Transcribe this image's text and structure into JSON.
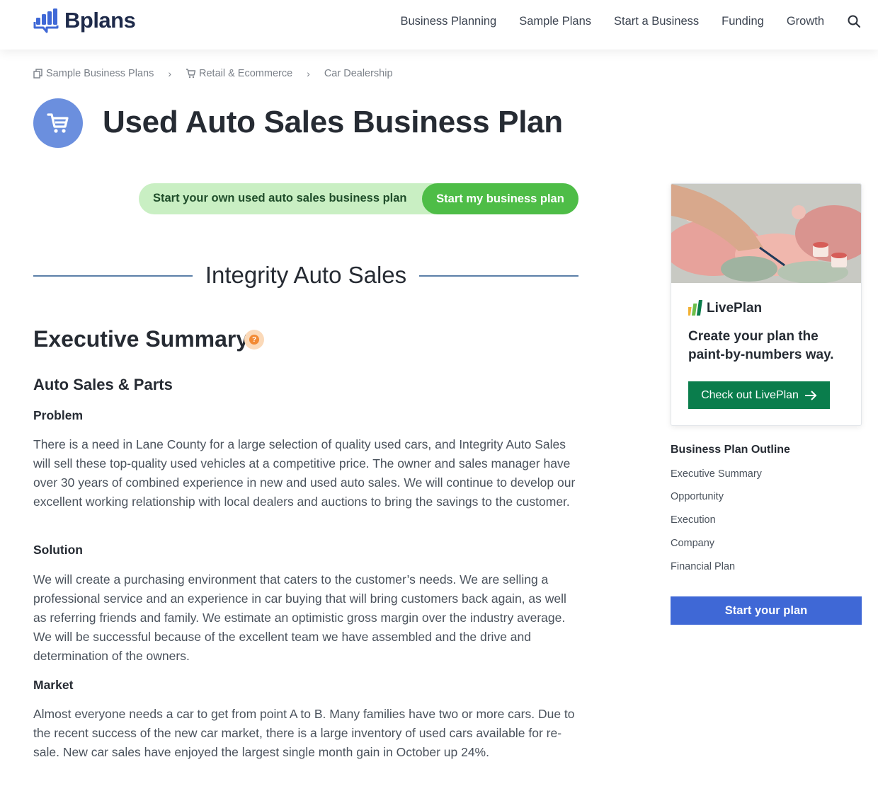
{
  "header": {
    "logo_text": "Bplans",
    "nav": [
      "Business Planning",
      "Sample Plans",
      "Start a Business",
      "Funding",
      "Growth"
    ],
    "search_icon": "search-icon"
  },
  "breadcrumb": {
    "items": [
      "Sample Business Plans",
      "Retail & Ecommerce",
      "Car Dealership"
    ],
    "icons": [
      "documents-icon",
      "cart-icon"
    ]
  },
  "title": {
    "text": "Used Auto Sales Business Plan",
    "icon": "shopping-cart-icon",
    "icon_color": "#6b8fde"
  },
  "cta": {
    "prompt": "Start your own used auto sales business plan",
    "button": "Start my business plan",
    "pill_color": "#c9efc3",
    "button_color": "#4ebd47"
  },
  "company_name": "Integrity Auto Sales",
  "main": {
    "exec_heading": "Executive Summary",
    "help_badge": "?",
    "sub_heading": "Auto Sales & Parts",
    "sections": [
      {
        "heading": "Problem",
        "text": "There is a need in Lane County for a large selection of quality used cars, and Integrity Auto Sales will sell these top-quality used vehicles at a competitive price. The owner and sales manager have over 30 years of combined experience in new and used auto sales. We will continue to develop our excellent working relationship with local dealers and auctions to bring the savings to the customer."
      },
      {
        "heading": "Solution",
        "text": "We will create a purchasing environment that caters to the customer’s needs. We are selling a professional service and an experience in car buying that will bring customers back again, as well as referring friends and family. We estimate an optimistic gross margin over the industry average. We will be successful because of the excellent team we have assembled and the drive and determination of the owners."
      },
      {
        "heading": "Market",
        "text": "Almost everyone needs a car to get from point A to B. Many families have two or more cars. Due to the recent success of the new car market, there is a large inventory of used cars available for re-sale. New car sales have enjoyed the largest single month gain in October up 24%."
      }
    ]
  },
  "sidebar": {
    "ad": {
      "brand": "LivePlan",
      "headline": "Create your plan the paint-by-numbers way.",
      "button": "Check out LivePlan",
      "button_color": "#0a7d4c"
    },
    "outline_title": "Business Plan Outline",
    "outline_items": [
      "Executive Summary",
      "Opportunity",
      "Execution",
      "Company",
      "Financial Plan"
    ],
    "start_button": "Start your plan",
    "start_button_color": "#3f68d6"
  }
}
